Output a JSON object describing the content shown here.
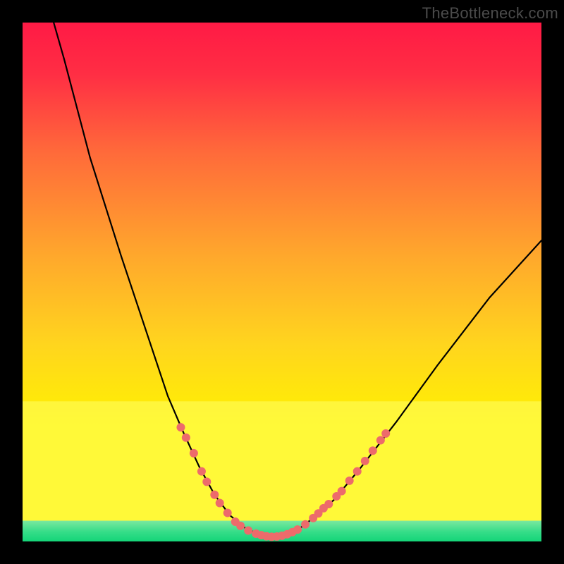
{
  "watermark": "TheBottleneck.com",
  "chart_data": {
    "type": "line",
    "title": "",
    "xlabel": "",
    "ylabel": "",
    "xlim": [
      0,
      100
    ],
    "ylim": [
      0,
      100
    ],
    "curve_left": [
      {
        "x": 6,
        "y": 100
      },
      {
        "x": 8,
        "y": 93
      },
      {
        "x": 13,
        "y": 74
      },
      {
        "x": 19,
        "y": 55
      },
      {
        "x": 25,
        "y": 37
      },
      {
        "x": 28,
        "y": 28
      },
      {
        "x": 31,
        "y": 21
      },
      {
        "x": 34,
        "y": 14.5
      },
      {
        "x": 37,
        "y": 9
      },
      {
        "x": 40,
        "y": 5
      },
      {
        "x": 43,
        "y": 2.5
      },
      {
        "x": 46,
        "y": 1.2
      },
      {
        "x": 48,
        "y": 0.9
      }
    ],
    "curve_right": [
      {
        "x": 48,
        "y": 0.9
      },
      {
        "x": 50,
        "y": 1.1
      },
      {
        "x": 53,
        "y": 2.2
      },
      {
        "x": 56,
        "y": 4.5
      },
      {
        "x": 60,
        "y": 8
      },
      {
        "x": 65,
        "y": 14
      },
      {
        "x": 72,
        "y": 23
      },
      {
        "x": 80,
        "y": 34
      },
      {
        "x": 90,
        "y": 47
      },
      {
        "x": 100,
        "y": 58
      }
    ],
    "markers_left": [
      {
        "x": 30.5,
        "y": 22
      },
      {
        "x": 31.5,
        "y": 20
      },
      {
        "x": 33.0,
        "y": 17
      },
      {
        "x": 34.5,
        "y": 13.5
      },
      {
        "x": 35.5,
        "y": 11.5
      },
      {
        "x": 37.0,
        "y": 9.0
      },
      {
        "x": 38.0,
        "y": 7.4
      },
      {
        "x": 39.5,
        "y": 5.5
      },
      {
        "x": 41.0,
        "y": 3.8
      },
      {
        "x": 42.0,
        "y": 3.0
      },
      {
        "x": 43.5,
        "y": 2.1
      },
      {
        "x": 45.0,
        "y": 1.5
      },
      {
        "x": 46.0,
        "y": 1.2
      },
      {
        "x": 47.0,
        "y": 1.0
      },
      {
        "x": 48.0,
        "y": 0.9
      }
    ],
    "markers_right": [
      {
        "x": 49.0,
        "y": 0.95
      },
      {
        "x": 50.0,
        "y": 1.1
      },
      {
        "x": 51.0,
        "y": 1.4
      },
      {
        "x": 52.0,
        "y": 1.8
      },
      {
        "x": 53.0,
        "y": 2.3
      },
      {
        "x": 54.5,
        "y": 3.3
      },
      {
        "x": 56.0,
        "y": 4.5
      },
      {
        "x": 57.0,
        "y": 5.4
      },
      {
        "x": 58.0,
        "y": 6.4
      },
      {
        "x": 59.0,
        "y": 7.2
      },
      {
        "x": 60.5,
        "y": 8.7
      },
      {
        "x": 61.5,
        "y": 9.7
      },
      {
        "x": 63.0,
        "y": 11.7
      },
      {
        "x": 64.5,
        "y": 13.5
      },
      {
        "x": 66.0,
        "y": 15.5
      },
      {
        "x": 67.5,
        "y": 17.5
      },
      {
        "x": 69.0,
        "y": 19.5
      },
      {
        "x": 70.0,
        "y": 20.8
      }
    ],
    "green_band_bottom": 0,
    "green_band_top": 4,
    "lower_highlight_top": 27,
    "marker_color": "#ed6b6b",
    "line_color": "#000000"
  }
}
